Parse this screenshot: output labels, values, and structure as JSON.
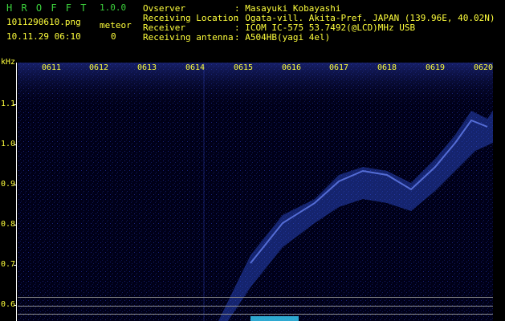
{
  "app": {
    "title": "H R O F F T",
    "version": "1.0.0"
  },
  "file": {
    "name": "1011290610.png",
    "datetime": "10.11.29 06:10"
  },
  "meteor": {
    "label": "meteor",
    "count": "0"
  },
  "station": [
    {
      "label": "Ovserver",
      "value": ": Masayuki Kobayashi"
    },
    {
      "label": "Receiving Location",
      "value": ": Ogata-vill. Akita-Pref. JAPAN (139.96E, 40.02N)"
    },
    {
      "label": "Receiver",
      "value": ": ICOM IC-575 53.7492(@LCD)MHz USB"
    },
    {
      "label": "Receiving antenna",
      "value": ": A504HB(yagi 4el)"
    }
  ],
  "axis": {
    "unit": "kHz",
    "y_ticks": [
      "1.1",
      "1.0",
      "0.9",
      "0.8",
      "0.7",
      "0.6"
    ],
    "time_ticks": [
      "0611",
      "0612",
      "0613",
      "0614",
      "0615",
      "0616",
      "0617",
      "0618",
      "0619",
      "0620"
    ]
  },
  "colors": {
    "header_green": "#3cd23c",
    "label_yellow": "#ffff3c",
    "background": "#000000",
    "signal": "#3c64ff"
  }
}
